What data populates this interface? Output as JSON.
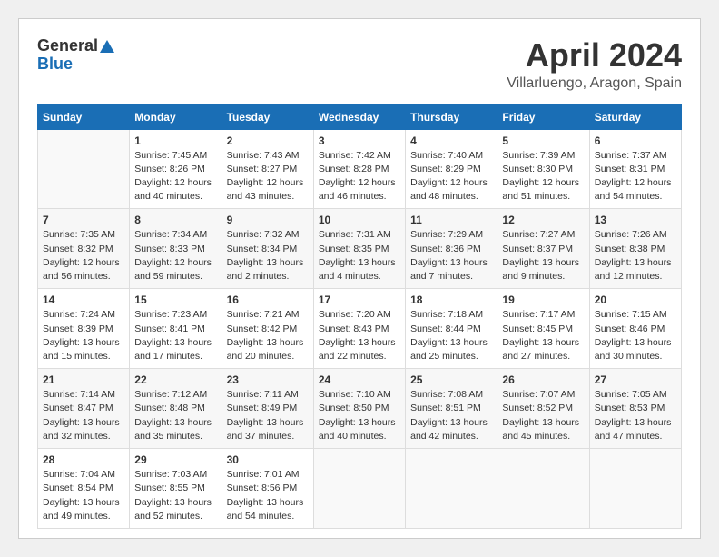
{
  "header": {
    "logo_general": "General",
    "logo_blue": "Blue",
    "title": "April 2024",
    "location": "Villarluengo, Aragon, Spain"
  },
  "columns": [
    "Sunday",
    "Monday",
    "Tuesday",
    "Wednesday",
    "Thursday",
    "Friday",
    "Saturday"
  ],
  "weeks": [
    [
      {
        "day": "",
        "data": ""
      },
      {
        "day": "1",
        "data": "Sunrise: 7:45 AM\nSunset: 8:26 PM\nDaylight: 12 hours\nand 40 minutes."
      },
      {
        "day": "2",
        "data": "Sunrise: 7:43 AM\nSunset: 8:27 PM\nDaylight: 12 hours\nand 43 minutes."
      },
      {
        "day": "3",
        "data": "Sunrise: 7:42 AM\nSunset: 8:28 PM\nDaylight: 12 hours\nand 46 minutes."
      },
      {
        "day": "4",
        "data": "Sunrise: 7:40 AM\nSunset: 8:29 PM\nDaylight: 12 hours\nand 48 minutes."
      },
      {
        "day": "5",
        "data": "Sunrise: 7:39 AM\nSunset: 8:30 PM\nDaylight: 12 hours\nand 51 minutes."
      },
      {
        "day": "6",
        "data": "Sunrise: 7:37 AM\nSunset: 8:31 PM\nDaylight: 12 hours\nand 54 minutes."
      }
    ],
    [
      {
        "day": "7",
        "data": "Sunrise: 7:35 AM\nSunset: 8:32 PM\nDaylight: 12 hours\nand 56 minutes."
      },
      {
        "day": "8",
        "data": "Sunrise: 7:34 AM\nSunset: 8:33 PM\nDaylight: 12 hours\nand 59 minutes."
      },
      {
        "day": "9",
        "data": "Sunrise: 7:32 AM\nSunset: 8:34 PM\nDaylight: 13 hours\nand 2 minutes."
      },
      {
        "day": "10",
        "data": "Sunrise: 7:31 AM\nSunset: 8:35 PM\nDaylight: 13 hours\nand 4 minutes."
      },
      {
        "day": "11",
        "data": "Sunrise: 7:29 AM\nSunset: 8:36 PM\nDaylight: 13 hours\nand 7 minutes."
      },
      {
        "day": "12",
        "data": "Sunrise: 7:27 AM\nSunset: 8:37 PM\nDaylight: 13 hours\nand 9 minutes."
      },
      {
        "day": "13",
        "data": "Sunrise: 7:26 AM\nSunset: 8:38 PM\nDaylight: 13 hours\nand 12 minutes."
      }
    ],
    [
      {
        "day": "14",
        "data": "Sunrise: 7:24 AM\nSunset: 8:39 PM\nDaylight: 13 hours\nand 15 minutes."
      },
      {
        "day": "15",
        "data": "Sunrise: 7:23 AM\nSunset: 8:41 PM\nDaylight: 13 hours\nand 17 minutes."
      },
      {
        "day": "16",
        "data": "Sunrise: 7:21 AM\nSunset: 8:42 PM\nDaylight: 13 hours\nand 20 minutes."
      },
      {
        "day": "17",
        "data": "Sunrise: 7:20 AM\nSunset: 8:43 PM\nDaylight: 13 hours\nand 22 minutes."
      },
      {
        "day": "18",
        "data": "Sunrise: 7:18 AM\nSunset: 8:44 PM\nDaylight: 13 hours\nand 25 minutes."
      },
      {
        "day": "19",
        "data": "Sunrise: 7:17 AM\nSunset: 8:45 PM\nDaylight: 13 hours\nand 27 minutes."
      },
      {
        "day": "20",
        "data": "Sunrise: 7:15 AM\nSunset: 8:46 PM\nDaylight: 13 hours\nand 30 minutes."
      }
    ],
    [
      {
        "day": "21",
        "data": "Sunrise: 7:14 AM\nSunset: 8:47 PM\nDaylight: 13 hours\nand 32 minutes."
      },
      {
        "day": "22",
        "data": "Sunrise: 7:12 AM\nSunset: 8:48 PM\nDaylight: 13 hours\nand 35 minutes."
      },
      {
        "day": "23",
        "data": "Sunrise: 7:11 AM\nSunset: 8:49 PM\nDaylight: 13 hours\nand 37 minutes."
      },
      {
        "day": "24",
        "data": "Sunrise: 7:10 AM\nSunset: 8:50 PM\nDaylight: 13 hours\nand 40 minutes."
      },
      {
        "day": "25",
        "data": "Sunrise: 7:08 AM\nSunset: 8:51 PM\nDaylight: 13 hours\nand 42 minutes."
      },
      {
        "day": "26",
        "data": "Sunrise: 7:07 AM\nSunset: 8:52 PM\nDaylight: 13 hours\nand 45 minutes."
      },
      {
        "day": "27",
        "data": "Sunrise: 7:05 AM\nSunset: 8:53 PM\nDaylight: 13 hours\nand 47 minutes."
      }
    ],
    [
      {
        "day": "28",
        "data": "Sunrise: 7:04 AM\nSunset: 8:54 PM\nDaylight: 13 hours\nand 49 minutes."
      },
      {
        "day": "29",
        "data": "Sunrise: 7:03 AM\nSunset: 8:55 PM\nDaylight: 13 hours\nand 52 minutes."
      },
      {
        "day": "30",
        "data": "Sunrise: 7:01 AM\nSunset: 8:56 PM\nDaylight: 13 hours\nand 54 minutes."
      },
      {
        "day": "",
        "data": ""
      },
      {
        "day": "",
        "data": ""
      },
      {
        "day": "",
        "data": ""
      },
      {
        "day": "",
        "data": ""
      }
    ]
  ]
}
